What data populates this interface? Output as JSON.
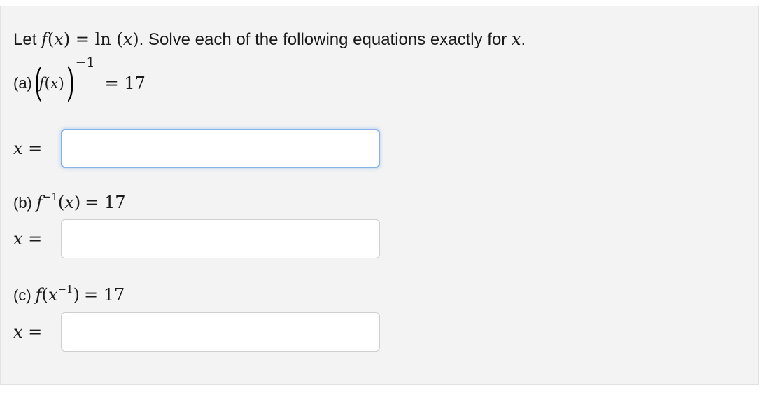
{
  "problem": {
    "intro_prefix": "Let ",
    "f": "f",
    "x": "x",
    "intro_eq": ") = ",
    "ln": "ln",
    "intro_suffix": ". Solve each of the following equations exactly for ",
    "period": "."
  },
  "parts": [
    {
      "label": "(a)",
      "func": "f",
      "var": "x",
      "exponent": "−1",
      "rhs": "= 17",
      "answer_label": "x =",
      "answer_value": ""
    },
    {
      "label": "(b)",
      "func": "f",
      "exponent": "−1",
      "var": "x",
      "rhs": "= 17",
      "answer_label": "x =",
      "answer_value": ""
    },
    {
      "label": "(c)",
      "func": "f",
      "var": "x",
      "exponent": "−1",
      "rhs": "= 17",
      "answer_label": "x =",
      "answer_value": ""
    }
  ]
}
